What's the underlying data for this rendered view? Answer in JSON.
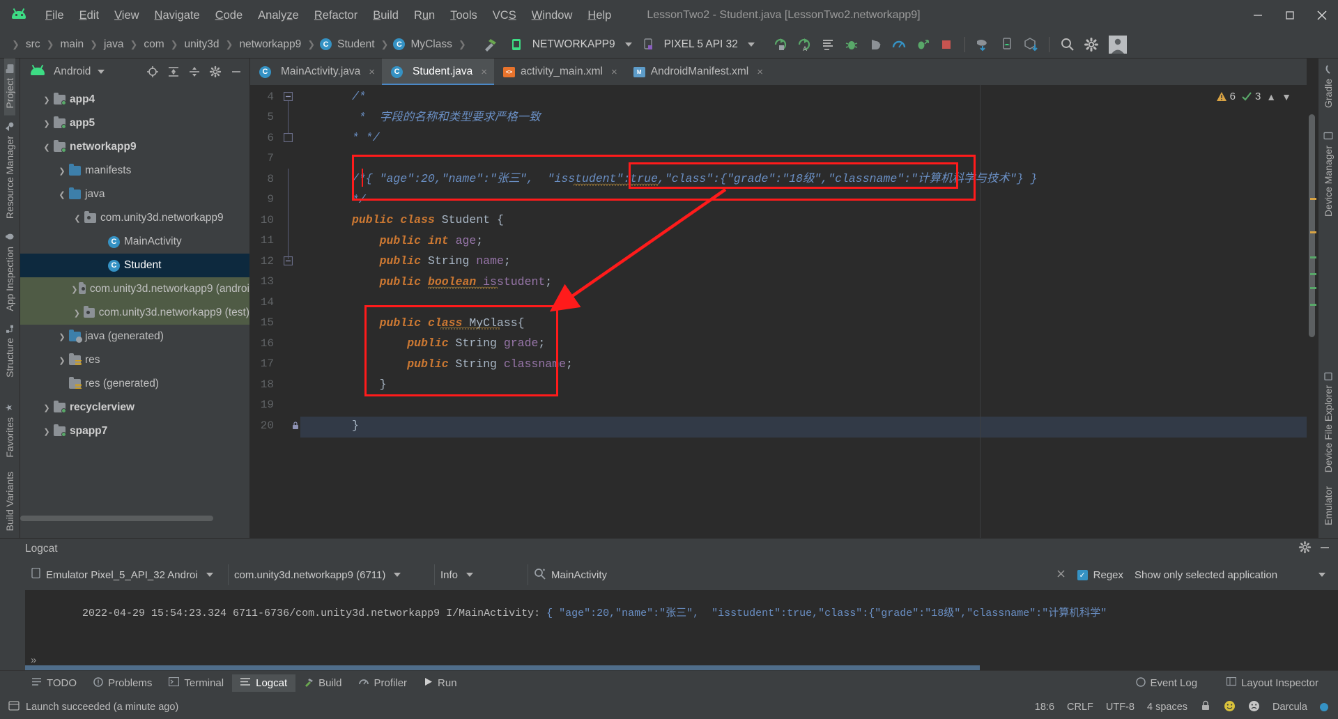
{
  "window": {
    "title": "LessonTwo2 - Student.java [LessonTwo2.networkapp9]",
    "minimize": "minimize",
    "maximize": "maximize",
    "close": "close"
  },
  "menu": [
    {
      "label": "File",
      "mnemonic": "F"
    },
    {
      "label": "Edit",
      "mnemonic": "E"
    },
    {
      "label": "View",
      "mnemonic": "V"
    },
    {
      "label": "Navigate",
      "mnemonic": "N"
    },
    {
      "label": "Code",
      "mnemonic": "C"
    },
    {
      "label": "Analyze",
      "mnemonic": "z"
    },
    {
      "label": "Refactor",
      "mnemonic": "R"
    },
    {
      "label": "Build",
      "mnemonic": "B"
    },
    {
      "label": "Run",
      "mnemonic": "u"
    },
    {
      "label": "Tools",
      "mnemonic": "T"
    },
    {
      "label": "VCS",
      "mnemonic": "S"
    },
    {
      "label": "Window",
      "mnemonic": "W"
    },
    {
      "label": "Help",
      "mnemonic": "H"
    }
  ],
  "breadcrumb": [
    {
      "label": "src",
      "icon": ""
    },
    {
      "label": "main",
      "icon": ""
    },
    {
      "label": "java",
      "icon": ""
    },
    {
      "label": "com",
      "icon": ""
    },
    {
      "label": "unity3d",
      "icon": ""
    },
    {
      "label": "networkapp9",
      "icon": ""
    },
    {
      "label": "Student",
      "icon": "class-icon"
    },
    {
      "label": "MyClass",
      "icon": "class-icon"
    }
  ],
  "toolbar": {
    "run_config": "NETWORKAPP9",
    "device": "PIXEL 5 API 32",
    "icons": [
      "run-icon",
      "run-with-coverage-icon",
      "rerun-icon",
      "debug-icon",
      "step-icon",
      "profiler-icon",
      "attach-debugger-icon",
      "stop-icon",
      "avd-manager-icon",
      "device-manager-icon",
      "sdk-manager-icon",
      "search-everywhere-icon",
      "settings-icon",
      "avatar-icon"
    ]
  },
  "left_rail": {
    "top": [
      "Project",
      "Resource Manager",
      "App Inspection",
      "Structure"
    ],
    "bottom": [
      "Favorites",
      "Build Variants"
    ]
  },
  "right_rail": {
    "items": [
      "Gradle",
      "Device Manager",
      "Device File Explorer",
      "Emulator"
    ]
  },
  "project": {
    "view_label": "Android",
    "head_icons": [
      "locate-icon",
      "expand-all-icon",
      "collapse-all-icon",
      "settings-icon",
      "hide-icon"
    ],
    "tree": [
      {
        "label": "app4",
        "depth": 0,
        "arrow": "collapsed",
        "icon": "module-folder-icon",
        "bold": true,
        "state": "normal"
      },
      {
        "label": "app5",
        "depth": 0,
        "arrow": "collapsed",
        "icon": "module-folder-icon",
        "bold": true,
        "state": "normal"
      },
      {
        "label": "networkapp9",
        "depth": 0,
        "arrow": "expanded",
        "icon": "module-folder-icon",
        "bold": true,
        "state": "normal"
      },
      {
        "label": "manifests",
        "depth": 1,
        "arrow": "collapsed",
        "icon": "blue-folder-icon",
        "bold": false,
        "state": "normal"
      },
      {
        "label": "java",
        "depth": 1,
        "arrow": "expanded",
        "icon": "blue-folder-icon",
        "bold": false,
        "state": "normal"
      },
      {
        "label": "com.unity3d.networkapp9",
        "depth": 2,
        "arrow": "expanded",
        "icon": "package-icon",
        "bold": false,
        "state": "normal"
      },
      {
        "label": "MainActivity",
        "depth": 3,
        "arrow": "none",
        "icon": "class-icon",
        "bold": false,
        "state": "normal"
      },
      {
        "label": "Student",
        "depth": 3,
        "arrow": "none",
        "icon": "class-icon",
        "bold": false,
        "state": "selected"
      },
      {
        "label": "com.unity3d.networkapp9 (androi",
        "depth": 2,
        "arrow": "collapsed",
        "icon": "package-icon",
        "bold": false,
        "state": "highlight"
      },
      {
        "label": "com.unity3d.networkapp9 (test)",
        "depth": 2,
        "arrow": "collapsed",
        "icon": "package-icon",
        "bold": false,
        "state": "highlight"
      },
      {
        "label": "java (generated)",
        "depth": 1,
        "arrow": "collapsed",
        "icon": "generated-folder-icon",
        "bold": false,
        "state": "normal"
      },
      {
        "label": "res",
        "depth": 1,
        "arrow": "collapsed",
        "icon": "res-folder-icon",
        "bold": false,
        "state": "normal"
      },
      {
        "label": "res (generated)",
        "depth": 1,
        "arrow": "none",
        "icon": "res-folder-icon",
        "bold": false,
        "state": "normal"
      },
      {
        "label": "recyclerview",
        "depth": 0,
        "arrow": "collapsed",
        "icon": "module-folder-icon",
        "bold": true,
        "state": "normal"
      },
      {
        "label": "spapp7",
        "depth": 0,
        "arrow": "collapsed",
        "icon": "module-folder-icon",
        "bold": true,
        "state": "normal"
      }
    ]
  },
  "editor": {
    "tabs": [
      {
        "label": "MainActivity.java",
        "icon": "java-class-icon",
        "active": false,
        "close": "×"
      },
      {
        "label": "Student.java",
        "icon": "java-class-icon",
        "active": true,
        "close": "×"
      },
      {
        "label": "activity_main.xml",
        "icon": "xml-layout-icon",
        "active": false,
        "close": "×"
      },
      {
        "label": "AndroidManifest.xml",
        "icon": "manifest-icon",
        "active": false,
        "close": "×"
      }
    ],
    "inspection": {
      "warnings": "6",
      "checks": "3",
      "up": "⌃",
      "down": "⌄"
    },
    "lines": [
      {
        "n": "4",
        "text": "/*"
      },
      {
        "n": "5",
        "text": " *  字段的名称和类型要求严格一致"
      },
      {
        "n": "6",
        "text": "* */"
      },
      {
        "n": "7",
        "text": ""
      },
      {
        "n": "8",
        "text": "/*{ \"age\":20,\"name\":\"张三\",  \"isstudent\":true,\"class\":{\"grade\":\"18级\",\"classname\":\"计算机科学与技术\"} }"
      },
      {
        "n": "9",
        "text": "*/"
      },
      {
        "n": "10",
        "text": "public class Student {"
      },
      {
        "n": "11",
        "text": "    public int age;"
      },
      {
        "n": "12",
        "text": "    public String name;"
      },
      {
        "n": "13",
        "text": "    public boolean isstudent;"
      },
      {
        "n": "14",
        "text": ""
      },
      {
        "n": "15",
        "text": "    public class MyClass{"
      },
      {
        "n": "16",
        "text": "        public String grade;"
      },
      {
        "n": "17",
        "text": "        public String classname;"
      },
      {
        "n": "18",
        "text": "    }"
      },
      {
        "n": "19",
        "text": ""
      },
      {
        "n": "20",
        "text": "}"
      }
    ]
  },
  "logcat": {
    "title": "Logcat",
    "device": "Emulator Pixel_5_API_32 Androi",
    "process": "com.unity3d.networkapp9 (6711)",
    "level": "Info",
    "filter_value": "MainActivity",
    "filter_placeholder": "MainActivity",
    "regex_label": "Regex",
    "scope": "Show only selected application",
    "entry": {
      "prefix": "2022-04-29 15:54:23.324 6711-6736/com.unity3d.networkapp9 I/MainActivity: ",
      "json": "{ \"age\":20,\"name\":\"张三\",  \"isstudent\":true,\"class\":{\"grade\":\"18级\",\"classname\":\"计算机科学\""
    }
  },
  "bottom_tabs": [
    {
      "label": "TODO",
      "icon": "todo-icon",
      "active": false
    },
    {
      "label": "Problems",
      "icon": "problems-icon",
      "active": false
    },
    {
      "label": "Terminal",
      "icon": "terminal-icon",
      "active": false
    },
    {
      "label": "Logcat",
      "icon": "logcat-icon",
      "active": true
    },
    {
      "label": "Build",
      "icon": "build-icon",
      "active": false
    },
    {
      "label": "Profiler",
      "icon": "profiler-icon",
      "active": false
    },
    {
      "label": "Run",
      "icon": "run-icon",
      "active": false
    }
  ],
  "bottom_right": [
    {
      "label": "Event Log",
      "icon": "event-log-icon"
    },
    {
      "label": "Layout Inspector",
      "icon": "layout-inspector-icon"
    }
  ],
  "status": {
    "message": "Launch succeeded (a minute ago)",
    "caret": "18:6",
    "line_ending": "CRLF",
    "encoding": "UTF-8",
    "indent": "4 spaces",
    "theme": "Darcula"
  },
  "colors": {
    "accent_blue": "#3592c4",
    "annotation_red": "#ff1b1b",
    "green": "#3ddc84",
    "selection": "#0d293e",
    "highlight": "#4f5b45",
    "code_bg": "#2b2b2b",
    "chrome_bg": "#3c3f41"
  }
}
